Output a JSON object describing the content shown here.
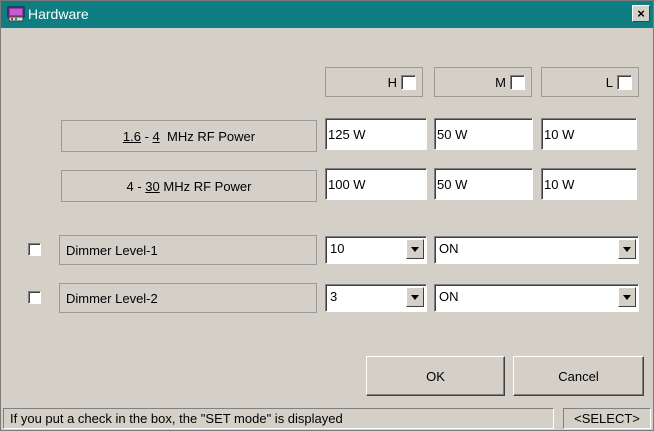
{
  "window": {
    "title": "Hardware",
    "close_label": "×"
  },
  "columns": [
    {
      "label": "H",
      "checked": false
    },
    {
      "label": "M",
      "checked": false
    },
    {
      "label": "L",
      "checked": false
    }
  ],
  "rf_rows": [
    {
      "range_low": "1.6",
      "range_high": "4",
      "unit_text": "MHz RF Power",
      "values": [
        "125 W",
        "50 W",
        "10 W"
      ]
    },
    {
      "range_low": "4",
      "range_high": "30",
      "unit_text": "MHz RF Power",
      "values": [
        "100 W",
        "50 W",
        "10 W"
      ]
    }
  ],
  "dimmer_rows": [
    {
      "label": "Dimmer Level-1",
      "checked": false,
      "level": "10",
      "state": "ON"
    },
    {
      "label": "Dimmer Level-2",
      "checked": false,
      "level": "3",
      "state": "ON"
    }
  ],
  "buttons": {
    "ok": "OK",
    "cancel": "Cancel"
  },
  "status": {
    "message": "If you put a check in the box, the \"SET mode\" is displayed",
    "mode": "<SELECT>"
  },
  "icons": {
    "app": "hardware-app-icon",
    "close": "close-icon",
    "dropdown": "chevron-down-icon"
  }
}
